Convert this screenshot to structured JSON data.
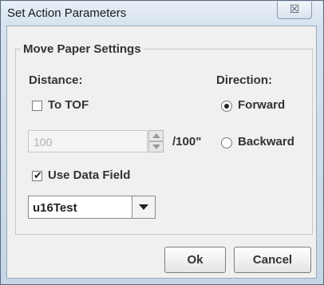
{
  "window": {
    "title": "Set Action Parameters",
    "close_glyph": "☒"
  },
  "group": {
    "title": "Move Paper Settings"
  },
  "distance": {
    "label": "Distance:",
    "to_tof_label": "To TOF",
    "to_tof_checked": false,
    "value": "100",
    "unit": "/100\""
  },
  "direction": {
    "label": "Direction:",
    "options": [
      "Forward",
      "Backward"
    ],
    "selected": "Forward"
  },
  "use_data_field": {
    "label": "Use Data Field",
    "checked": true,
    "check_glyph": "✔"
  },
  "data_field": {
    "selected": "u16Test"
  },
  "buttons": {
    "ok": "Ok",
    "cancel": "Cancel"
  },
  "icons": {
    "close": "close-icon",
    "spinner_up": "chevron-up-icon",
    "spinner_down": "chevron-down-icon",
    "combo_arrow": "chevron-down-icon",
    "radio_selected": "radio-dot-icon"
  }
}
